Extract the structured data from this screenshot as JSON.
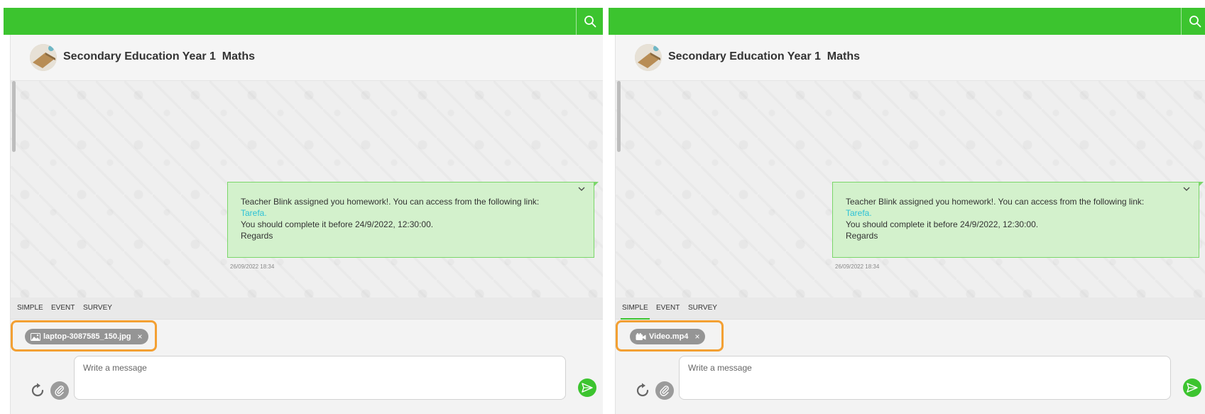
{
  "theme": {
    "accent": "#3cc42f",
    "bubble": "#d3f1cc",
    "link": "#2bc1d6",
    "highlight": "#f3a033"
  },
  "panels": [
    {
      "search_icon": "search-icon",
      "chat_title": "Secondary Education Year 1  Maths",
      "message": {
        "line1": "Teacher Blink assigned you homework!. You can access from the following link:",
        "link": "Tarefa.",
        "line3": "You should complete it before  24/9/2022, 12:30:00.",
        "line4": "Regards",
        "timestamp": "26/09/2022 18:34"
      },
      "tabs": [
        "SIMPLE",
        "EVENT",
        "SURVEY"
      ],
      "active_tab": "",
      "attachment": {
        "name": "laptop-3087585_150.jpg",
        "icon": "image-icon",
        "close": "×"
      },
      "composer": {
        "placeholder": "Write a message"
      }
    },
    {
      "search_icon": "search-icon",
      "chat_title": "Secondary Education Year 1  Maths",
      "message": {
        "line1": "Teacher Blink assigned you homework!. You can access from the following link:",
        "link": "Tarefa.",
        "line3": "You should complete it before  24/9/2022, 12:30:00.",
        "line4": "Regards",
        "timestamp": "26/09/2022 18:34"
      },
      "tabs": [
        "SIMPLE",
        "EVENT",
        "SURVEY"
      ],
      "active_tab": "SIMPLE",
      "attachment": {
        "name": "Video.mp4",
        "icon": "video-camera-icon",
        "close": "×"
      },
      "composer": {
        "placeholder": "Write a message"
      }
    }
  ]
}
